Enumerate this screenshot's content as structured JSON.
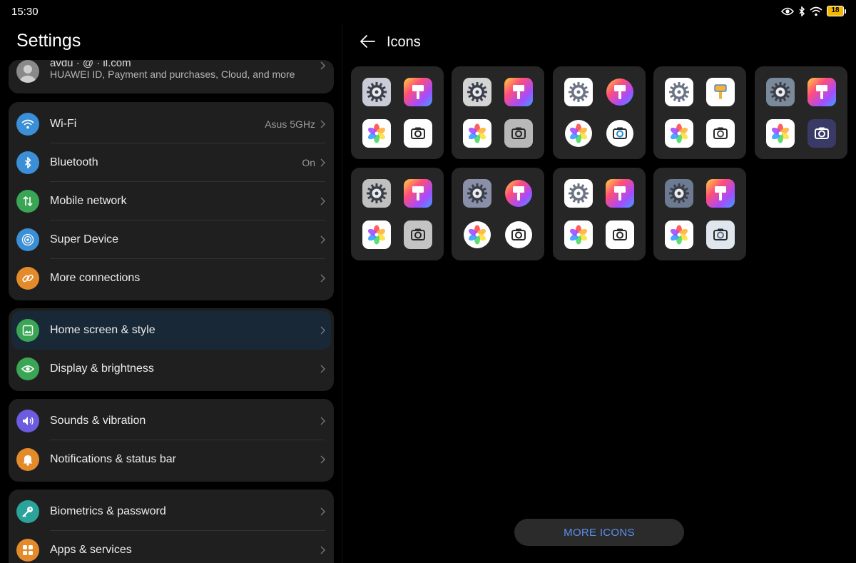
{
  "status_bar": {
    "time": "15:30",
    "icons": [
      "eye-icon",
      "bluetooth-icon",
      "wifi-icon"
    ],
    "battery_level": "18",
    "battery_fraction": 0.18,
    "battery_color": "#f2b705"
  },
  "settings": {
    "title": "Settings",
    "account": {
      "name_partial": "avdu · @ · il.com",
      "subtitle": "HUAWEI ID, Payment and purchases, Cloud, and more"
    },
    "groups": [
      [
        {
          "label": "Wi-Fi",
          "value": "Asus 5GHz",
          "icon": "wifi-icon",
          "color": "#3b8fd6"
        },
        {
          "label": "Bluetooth",
          "value": "On",
          "icon": "bluetooth-icon",
          "color": "#3b8fd6"
        },
        {
          "label": "Mobile network",
          "value": "",
          "icon": "mobile-network-icon",
          "color": "#3aa655"
        },
        {
          "label": "Super Device",
          "value": "",
          "icon": "super-device-icon",
          "color": "#3b8fd6"
        },
        {
          "label": "More connections",
          "value": "",
          "icon": "link-icon",
          "color": "#e38a2b"
        }
      ],
      [
        {
          "label": "Home screen & style",
          "value": "",
          "icon": "image-icon",
          "color": "#3aa655",
          "active": true
        },
        {
          "label": "Display & brightness",
          "value": "",
          "icon": "eye-icon",
          "color": "#3aa655"
        }
      ],
      [
        {
          "label": "Sounds & vibration",
          "value": "",
          "icon": "speaker-icon",
          "color": "#6b5ce0"
        },
        {
          "label": "Notifications & status bar",
          "value": "",
          "icon": "bell-icon",
          "color": "#e38a2b"
        }
      ],
      [
        {
          "label": "Biometrics & password",
          "value": "",
          "icon": "key-icon",
          "color": "#2aa39a"
        },
        {
          "label": "Apps & services",
          "value": "",
          "icon": "apps-grid-icon",
          "color": "#e38a2b"
        }
      ]
    ]
  },
  "icons_page": {
    "title": "Icons",
    "more_button": "MORE ICONS",
    "accent_color": "#5b8ff0",
    "themes": [
      {
        "settings_bg": "#c9ccd6",
        "brush_bg": "rainbow",
        "photos_bg": "#ffffff",
        "camera_bg": "#ffffff",
        "camera_lens": "#222222"
      },
      {
        "settings_bg": "#d4d4d4",
        "brush_bg": "rainbow",
        "photos_bg": "#ffffff",
        "camera_bg": "#b8b8b8",
        "camera_lens": "#222222"
      },
      {
        "settings_bg": "#ffffff",
        "brush_bg": "rainbow-circle",
        "photos_bg": "#ffffff",
        "camera_bg": "#ffffff",
        "camera_lens": "#1b8fd6"
      },
      {
        "settings_bg": "#ffffff",
        "brush_bg": "#ffffff",
        "photos_bg": "#ffffff",
        "camera_bg": "#ffffff",
        "camera_lens": "#444444"
      },
      {
        "settings_bg": "#7a8a9a",
        "brush_bg": "rainbow",
        "photos_bg": "#ffffff",
        "camera_bg": "#3a3a66",
        "camera_lens": "#ffffff"
      },
      {
        "settings_bg": "#c0c0c0",
        "brush_bg": "rainbow",
        "photos_bg": "#ffffff",
        "camera_bg": "#c4c4c4",
        "camera_lens": "#222222"
      },
      {
        "settings_bg": "#8a90a8",
        "brush_bg": "rainbow-circle",
        "photos_bg": "#ffffff",
        "camera_bg": "#ffffff",
        "camera_lens": "#222222"
      },
      {
        "settings_bg": "#ffffff",
        "brush_bg": "rainbow",
        "photos_bg": "#ffffff",
        "camera_bg": "#ffffff",
        "camera_lens": "#222222"
      },
      {
        "settings_bg": "#6c7a92",
        "brush_bg": "rainbow",
        "photos_bg": "#ffffff",
        "camera_bg": "#dfe6ee",
        "camera_lens": "#5a6a86"
      }
    ]
  }
}
